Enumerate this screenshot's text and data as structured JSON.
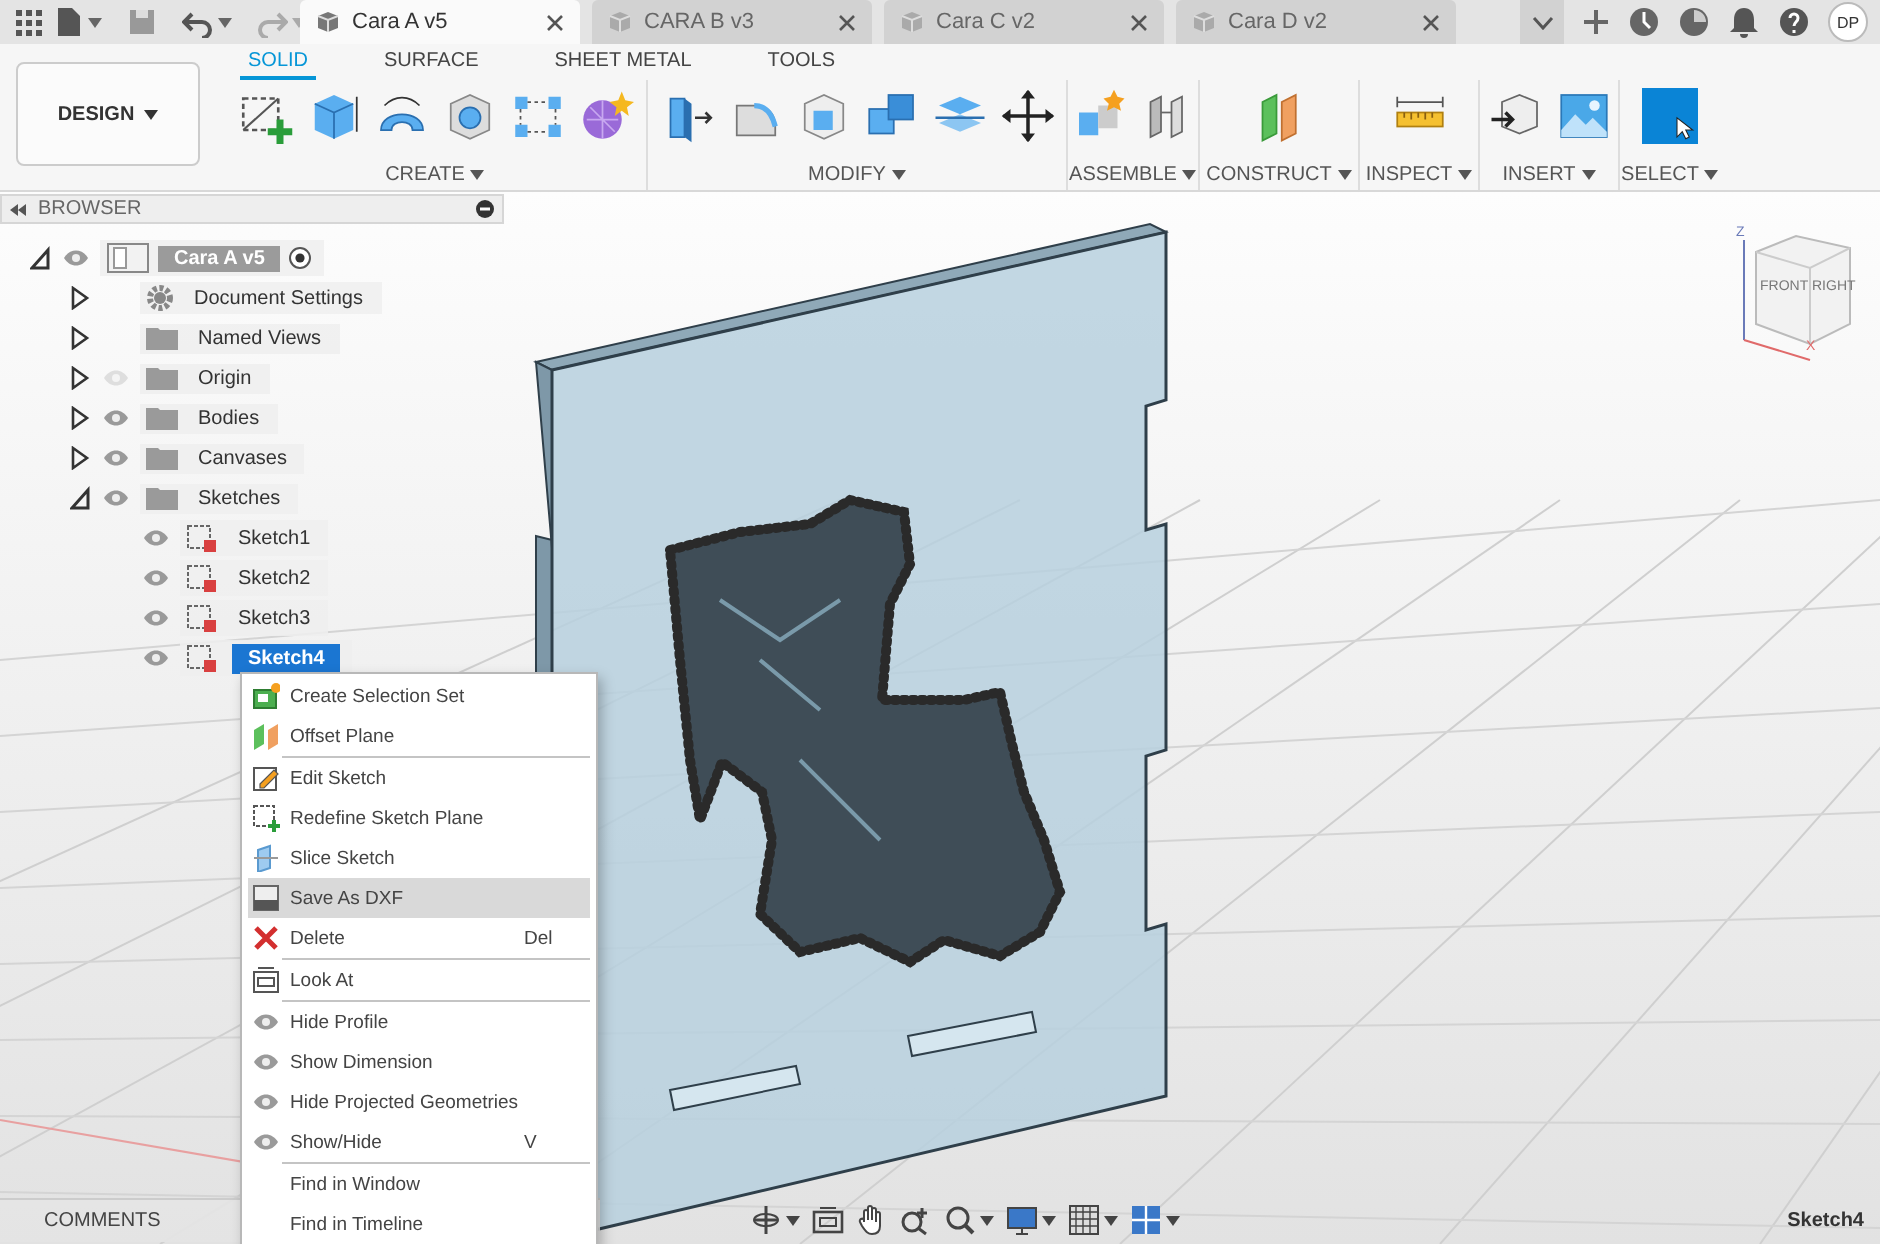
{
  "top_bar": {
    "tabs": [
      {
        "label": "Cara A v5",
        "selected": true
      },
      {
        "label": "CARA B v3",
        "selected": false
      },
      {
        "label": "Cara C v2",
        "selected": false
      },
      {
        "label": "Cara D v2",
        "selected": false
      }
    ],
    "avatar": "DP"
  },
  "toolbar": {
    "workspace": "DESIGN",
    "tabs": [
      {
        "label": "SOLID",
        "selected": true
      },
      {
        "label": "SURFACE",
        "selected": false
      },
      {
        "label": "SHEET METAL",
        "selected": false
      },
      {
        "label": "TOOLS",
        "selected": false
      }
    ],
    "groups": [
      {
        "label": "CREATE"
      },
      {
        "label": "MODIFY"
      },
      {
        "label": "ASSEMBLE"
      },
      {
        "label": "CONSTRUCT"
      },
      {
        "label": "INSPECT"
      },
      {
        "label": "INSERT"
      },
      {
        "label": "SELECT"
      }
    ]
  },
  "browser": {
    "title": "BROWSER",
    "tree": [
      {
        "label": "Cara A v5",
        "kind": "component",
        "expanded": true,
        "visible": true,
        "active": true,
        "selected": false,
        "children": [
          {
            "label": "Document Settings",
            "kind": "settings",
            "expanded": false,
            "selected": false
          },
          {
            "label": "Named Views",
            "kind": "folder",
            "expanded": false,
            "selected": false
          },
          {
            "label": "Origin",
            "kind": "folder",
            "expanded": false,
            "visible": false,
            "selected": false
          },
          {
            "label": "Bodies",
            "kind": "folder",
            "expanded": false,
            "visible": true,
            "selected": false
          },
          {
            "label": "Canvases",
            "kind": "folder",
            "expanded": false,
            "visible": true,
            "selected": false
          },
          {
            "label": "Sketches",
            "kind": "folder",
            "expanded": true,
            "visible": true,
            "selected": false,
            "children": [
              {
                "label": "Sketch1",
                "kind": "sketch",
                "visible": true,
                "selected": false
              },
              {
                "label": "Sketch2",
                "kind": "sketch",
                "visible": true,
                "selected": false
              },
              {
                "label": "Sketch3",
                "kind": "sketch",
                "visible": true,
                "selected": false
              },
              {
                "label": "Sketch4",
                "kind": "sketch",
                "visible": true,
                "selected": true
              }
            ]
          }
        ]
      }
    ]
  },
  "context_menu": {
    "groups": [
      [
        {
          "label": "Create Selection Set",
          "kind": "selection-set",
          "selected": false
        },
        {
          "label": "Offset Plane",
          "kind": "plane",
          "selected": false
        }
      ],
      [
        {
          "label": "Edit Sketch",
          "kind": "edit",
          "selected": false
        },
        {
          "label": "Redefine Sketch Plane",
          "kind": "redefine",
          "selected": false
        },
        {
          "label": "Slice Sketch",
          "kind": "slice",
          "selected": false
        },
        {
          "label": "Save As DXF",
          "kind": "dxf",
          "selected": true
        },
        {
          "label": "Delete",
          "kind": "delete",
          "shortcut": "Del",
          "selected": false
        }
      ],
      [
        {
          "label": "Look At",
          "kind": "look",
          "selected": false
        }
      ],
      [
        {
          "label": "Hide Profile",
          "kind": "eye",
          "selected": false
        },
        {
          "label": "Show Dimension",
          "kind": "eye",
          "selected": false
        },
        {
          "label": "Hide Projected Geometries",
          "kind": "eye",
          "selected": false
        },
        {
          "label": "Show/Hide",
          "kind": "eye",
          "shortcut": "V",
          "selected": false
        }
      ],
      [
        {
          "label": "Find in Window",
          "kind": "none",
          "selected": false
        },
        {
          "label": "Find in Timeline",
          "kind": "none",
          "selected": false
        }
      ]
    ]
  },
  "view_cube": {
    "faces": [
      "FRONT",
      "RIGHT"
    ],
    "axes": [
      "Z",
      "X"
    ]
  },
  "comments_panel": {
    "title": "COMMENTS"
  },
  "status": "Sketch4"
}
